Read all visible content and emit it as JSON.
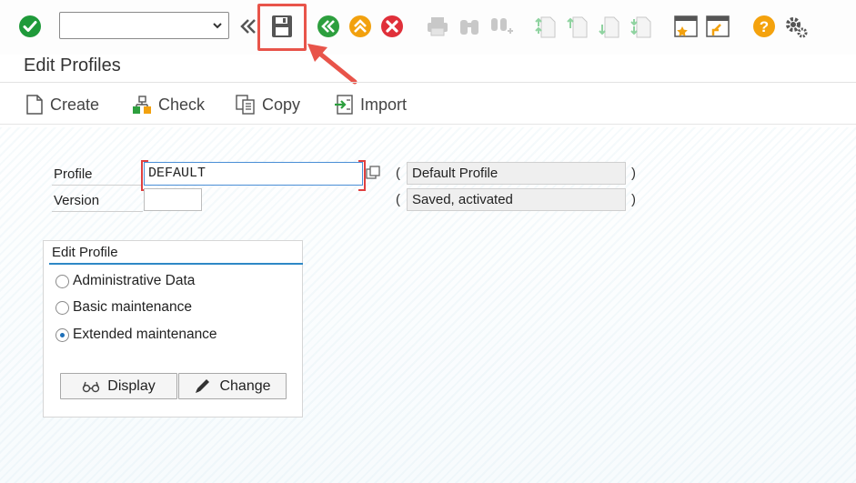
{
  "toolbar": {
    "command_field": {
      "value": "",
      "placeholder": ""
    },
    "icons": [
      "enter-icon",
      "back-nav-icon",
      "save-icon",
      "back-icon",
      "exit-icon",
      "cancel-icon",
      "print-icon",
      "find-icon",
      "find-next-icon",
      "first-page-icon",
      "previous-page-icon",
      "next-page-icon",
      "last-page-icon",
      "new-session-icon",
      "shortcut-icon",
      "help-icon",
      "settings-icon"
    ]
  },
  "page": {
    "title": "Edit Profiles"
  },
  "app_toolbar": {
    "create_label": "Create",
    "check_label": "Check",
    "copy_label": "Copy",
    "import_label": "Import"
  },
  "form": {
    "profile_label": "Profile",
    "profile_value": "DEFAULT",
    "profile_description": "Default Profile",
    "version_label": "Version",
    "version_value": "",
    "version_status": "Saved, activated",
    "paren_open": "(",
    "paren_close": ")"
  },
  "edit_profile": {
    "title": "Edit Profile",
    "options": [
      {
        "label": "Administrative Data",
        "checked": false
      },
      {
        "label": "Basic maintenance",
        "checked": false
      },
      {
        "label": "Extended maintenance",
        "checked": true
      }
    ],
    "display_label": "Display",
    "change_label": "Change"
  },
  "colors": {
    "enter_green": "#1f9a3a",
    "nav_green": "#2d9f3e",
    "exit_orange": "#f2a10e",
    "cancel_red": "#e0303a",
    "help_orange": "#f4a20d",
    "highlight_red": "#e8544a",
    "group_line_blue": "#2e88c6"
  }
}
